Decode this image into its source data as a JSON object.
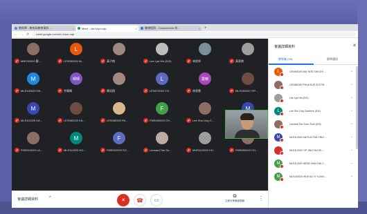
{
  "browser": {
    "tabs": [
      {
        "label": "教與學 - 教育局教育資訊 …",
        "color": "#4285f4",
        "active": false
      },
      {
        "label": "Meet - ufu-hxyn-vqb",
        "color": "#0f9d58",
        "active": true
      },
      {
        "label": "聯想相冊 - Classwerntie 的…",
        "color": "#1a73e8",
        "active": false
      }
    ],
    "url": "meet.google.com/ufu-hxyn-vqb",
    "new_tab": "+"
  },
  "participants_grid": [
    {
      "name": "MNI762020 鄭...",
      "initial": "",
      "color": "#8d6e63"
    },
    {
      "name": "LES062020 IA...",
      "initial": "L",
      "color": "#e8590c"
    },
    {
      "name": "黃子朗",
      "initial": "",
      "color": "#a1887f"
    },
    {
      "name": "Lee Lye Hin (5J2)",
      "initial": "",
      "color": "#bdbdbd"
    },
    {
      "name": "林旼妤",
      "initial": "",
      "color": "#78909c"
    },
    {
      "name": "黃東朗",
      "initial": "",
      "color": "#9e9e9e"
    },
    {
      "name": "MLS142020 HA...",
      "initial": "M",
      "color": "#1e88e5"
    },
    {
      "name": "余曉晴",
      "initial": "晴晴",
      "color": "#7e57c2"
    },
    {
      "name": "陳浩翔",
      "initial": "",
      "color": "#a1887f"
    },
    {
      "name": "LES672020 CH...",
      "initial": "L",
      "color": "#5c6bc0"
    },
    {
      "name": "林晉雲",
      "initial": "雲曉",
      "color": "#ab47bc"
    },
    {
      "name": "MLS162020 YIP...",
      "initial": "",
      "color": "#6d4c41"
    },
    {
      "name": "MLS112020 KA...",
      "initial": "M",
      "color": "#3949ab"
    },
    {
      "name": "LES082020 KA...",
      "initial": "",
      "color": "#6d4c41"
    },
    {
      "name": "LES082020 PA...",
      "initial": "",
      "color": "#d7b98e"
    },
    {
      "name": "FMS052020 CH...",
      "initial": "F",
      "color": "#43a047"
    },
    {
      "name": "Lee Shu Ling C...",
      "initial": "",
      "color": "#8d6e63"
    },
    {
      "name": "MLS112020 YA...",
      "initial": "M",
      "color": "#3949ab"
    },
    {
      "name": "FMS022020 LA...",
      "initial": "",
      "color": "#8d6e63"
    },
    {
      "name": "MLS112020 HO...",
      "initial": "M",
      "color": "#00897b"
    },
    {
      "name": "FMS022020 SO...",
      "initial": "F",
      "color": "#5c6bc0"
    },
    {
      "name": "Leonard Tan So...",
      "initial": "",
      "color": "#bcaaa4"
    },
    {
      "name": "MWS112020 CH...",
      "initial": "",
      "color": "#9e9e9e"
    },
    {
      "name": "FMS052020 CH...",
      "initial": "",
      "color": "#8d6e63"
    }
  ],
  "controls": {
    "meeting_info": "會議詳細資料",
    "chevron": "^",
    "mic_icon": "✕",
    "hangup_icon": "☎",
    "cam_icon": "▭",
    "present_icon": "⧉",
    "present_label": "立即分享畫面簡報",
    "more_icon": "⋮"
  },
  "panel": {
    "title": "會議詳細資料",
    "close": "✕",
    "tab_people": "參與者 (39)",
    "tab_chat": "即時通訊",
    "members": [
      {
        "name": "LES062020 IAN TATE SIM CHI ...",
        "initial": "L",
        "color": "#e8590c"
      },
      {
        "name": "LES082020 PHUA KUE ZHI TIN ...",
        "initial": "",
        "color": "#8d6e63"
      },
      {
        "name": "Lee Lye Hin (5J2)",
        "initial": "",
        "color": "#9e9e9e"
      },
      {
        "name": "Lee Shu Ling Charlene (5J4)",
        "initial": "L",
        "color": "#00897b"
      },
      {
        "name": "Leonard Tan Soon Tock (5J3)",
        "initial": "",
        "color": "#8d6e63"
      },
      {
        "name": "MLS112020 KAITLIN TAN YING ...",
        "initial": "M",
        "color": "#3949ab"
      },
      {
        "name": "MLS112020 YIP JING HUI 5D ...",
        "initial": "",
        "color": "#d32f2f"
      },
      {
        "name": "MLS112020 HENG XING HUI C...",
        "initial": "M",
        "color": "#43a047"
      },
      {
        "name": "MLS142020 HEW SU YI YUXIN ...",
        "initial": "M",
        "color": "#43a047"
      }
    ]
  }
}
